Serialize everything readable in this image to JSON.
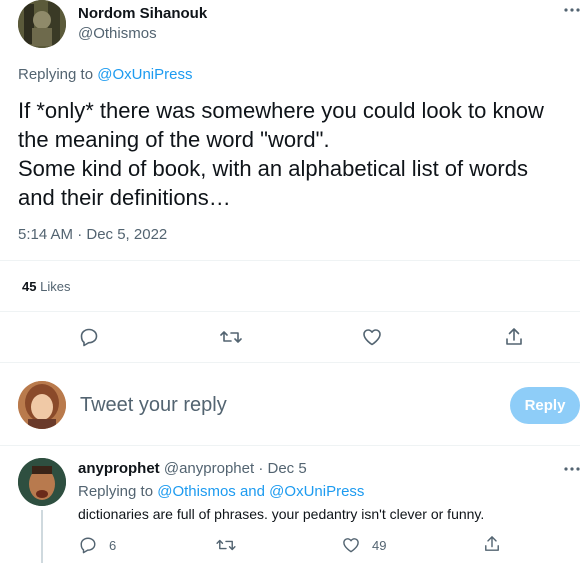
{
  "main_tweet": {
    "author_name": "Nordom Sihanouk",
    "author_handle": "@Othismos",
    "replying_prefix": "Replying to ",
    "replying_to": "@OxUniPress",
    "text_lines": [
      "If *only* there was somewhere you could look to know",
      "the meaning of the word \"word\".",
      "Some kind of book, with an alphabetical list of words",
      "and their definitions…"
    ],
    "timestamp": "5:14 AM · Dec 5, 2022",
    "likes_count": "45",
    "likes_label": "Likes"
  },
  "compose": {
    "placeholder": "Tweet your reply",
    "button_label": "Reply"
  },
  "reply_tweet": {
    "author_name": "anyprophet",
    "author_handle": "@anyprophet",
    "date": "· Dec 5",
    "replying_prefix": "Replying to ",
    "replying_to_1": "@Othismos",
    "replying_and": " and ",
    "replying_to_2": "@OxUniPress",
    "text": "dictionaries are full of phrases. your pedantry isn't clever or funny.",
    "reply_count": "6",
    "like_count": "49"
  },
  "colors": {
    "accent": "#1d9bf0",
    "reply_button_disabled": "#8ecdf8",
    "muted_text": "#536471",
    "divider": "#eff3f4"
  },
  "icons": [
    "more-dots-icon",
    "reply-icon",
    "retweet-icon",
    "like-icon",
    "share-icon"
  ]
}
